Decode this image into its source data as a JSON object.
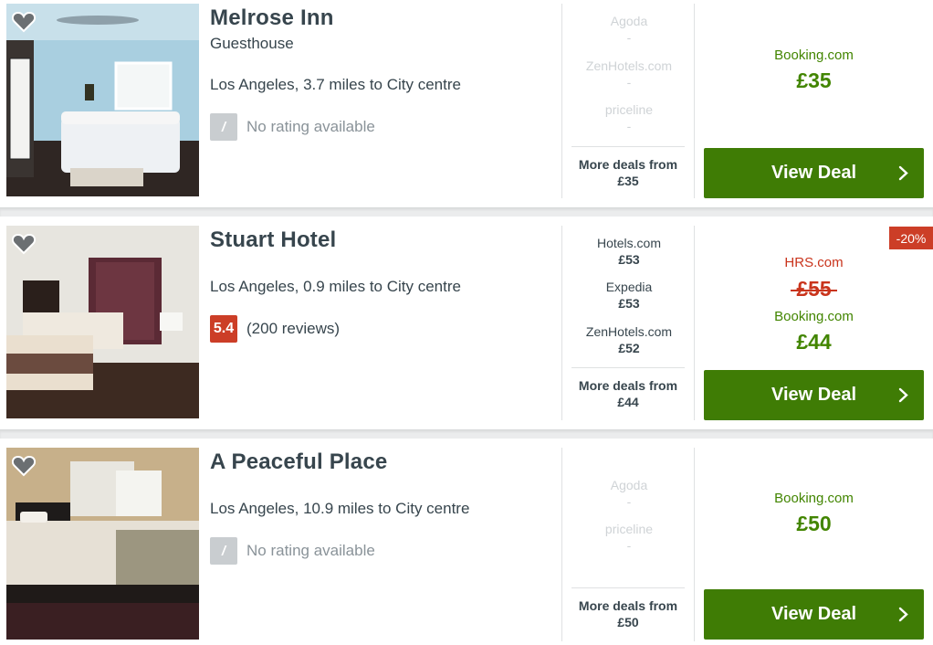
{
  "hotels": [
    {
      "name": "Melrose Inn",
      "type": "Guesthouse",
      "location": "Los Angeles, 3.7 miles to City centre",
      "rating": {
        "score": "/",
        "text": "No rating available"
      },
      "alt_deals": [
        {
          "site": "Agoda",
          "price": "-"
        },
        {
          "site": "ZenHotels.com",
          "price": "-"
        },
        {
          "site": "priceline",
          "price": "-"
        }
      ],
      "more_deals": {
        "label": "More deals from",
        "price": "£35"
      },
      "offer": {
        "site": "Booking.com",
        "price": "£35"
      },
      "button": "View Deal"
    },
    {
      "name": "Stuart Hotel",
      "location": "Los Angeles, 0.9 miles to City centre",
      "rating": {
        "score": "5.4",
        "text": "(200 reviews)"
      },
      "alt_deals": [
        {
          "site": "Hotels.com",
          "price": "£53"
        },
        {
          "site": "Expedia",
          "price": "£53"
        },
        {
          "site": "ZenHotels.com",
          "price": "£52"
        }
      ],
      "more_deals": {
        "label": "More deals from",
        "price": "£44"
      },
      "discount": "-20%",
      "old_offer": {
        "site": "HRS.com",
        "price": "£55"
      },
      "offer": {
        "site": "Booking.com",
        "price": "£44"
      },
      "button": "View Deal"
    },
    {
      "name": "A Peaceful Place",
      "location": "Los Angeles, 10.9 miles to City centre",
      "rating": {
        "score": "/",
        "text": "No rating available"
      },
      "alt_deals": [
        {
          "site": "Agoda",
          "price": "-"
        },
        {
          "site": "priceline",
          "price": "-"
        }
      ],
      "more_deals": {
        "label": "More deals from",
        "price": "£50"
      },
      "offer": {
        "site": "Booking.com",
        "price": "£50"
      },
      "button": "View Deal"
    }
  ],
  "icons": {
    "favorite": "heart-icon",
    "button_arrow": "chevron-right-icon"
  },
  "colors": {
    "price_green": "#428500",
    "button_green": "#3f7c05",
    "strike_red": "#c9341c",
    "rating_poor": "#cc3e27",
    "rating_none": "#c9cdd0"
  }
}
